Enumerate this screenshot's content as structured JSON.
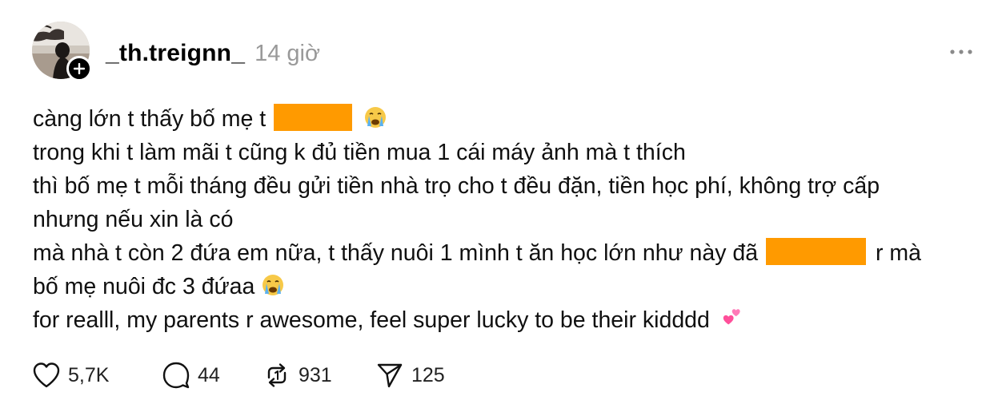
{
  "post": {
    "username": "_th.treignn_",
    "time": "14 giờ",
    "lines": [
      "càng lớn t thấy bố mẹ t",
      "trong khi t làm mãi t cũng k đủ tiền mua 1 cái máy ảnh mà t thích",
      "thì bố mẹ t mỗi tháng đều gửi tiền nhà trọ cho t đều đặn, tiền học phí, không trợ cấp",
      "nhưng nếu xin là có",
      "mà nhà t còn 2 đứa em nữa, t thấy nuôi 1 mình t ăn học lớn như này đã",
      "r mà",
      "bố mẹ nuôi đc 3 đứaa",
      "for realll, my parents r awesome, feel super lucky to be their kidddd"
    ],
    "emojis": [
      "crying-face",
      "crying-face",
      "two-hearts"
    ],
    "redaction_color": "#ff9a00"
  },
  "stats": {
    "likes": "5,7K",
    "replies": "44",
    "reposts": "931",
    "shares": "125"
  },
  "icons": [
    "more-icon",
    "heart-icon",
    "comment-icon",
    "repost-icon",
    "share-icon",
    "plus-icon"
  ]
}
